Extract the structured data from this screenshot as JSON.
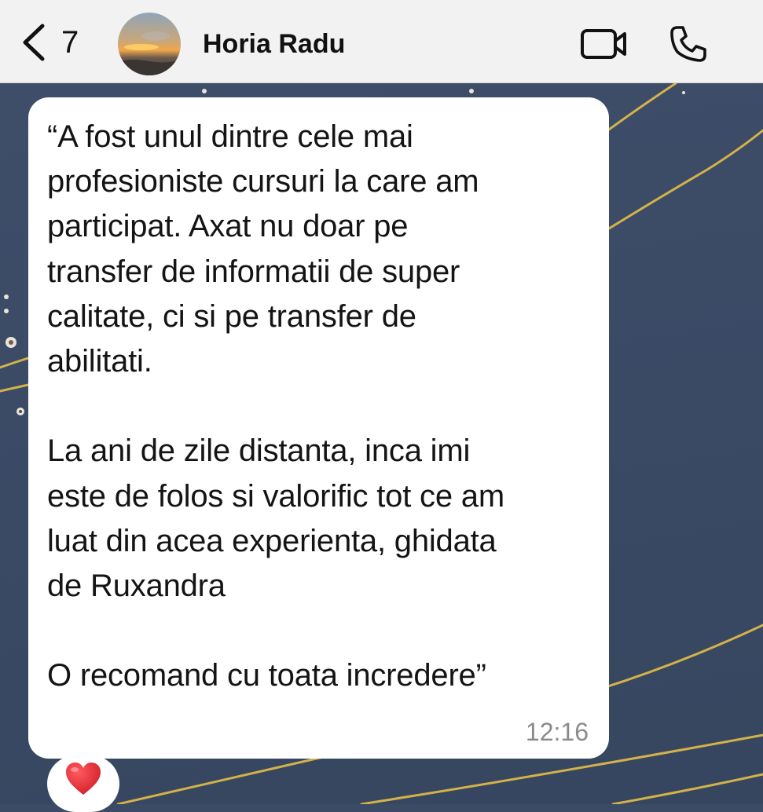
{
  "header": {
    "back_count": "7",
    "contact_name": "Horia Radu",
    "icons": [
      "chevron-left-icon",
      "video-call-icon",
      "phone-icon"
    ]
  },
  "message": {
    "text": "“A fost unul dintre cele mai\nprofesioniste cursuri la care am\nparticipat. Axat nu doar pe\ntransfer de informatii de super\ncalitate, ci si pe transfer de\nabilitati.\n\nLa ani de zile distanta, inca imi\neste de folos si valorific tot ce am\nluat din acea experienta, ghidata\nde Ruxandra\n\nO recomand cu toata incredere”",
    "time": "12:16",
    "reaction": "❤️"
  },
  "colors": {
    "header_bg": "#f2f2f2",
    "wallpaper": "#3b4b66",
    "wallpaper_lines": "#d4b24a",
    "bubble": "#ffffff",
    "reaction_heart": "#e0242c"
  }
}
